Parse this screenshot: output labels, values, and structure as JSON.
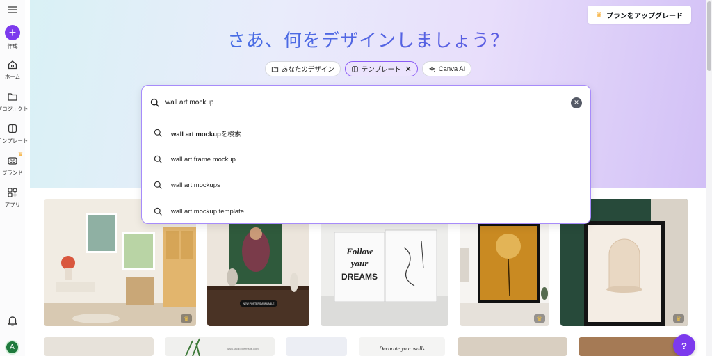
{
  "sidebar": {
    "create_label": "作成",
    "items": [
      {
        "label": "ホーム",
        "icon": "home-icon"
      },
      {
        "label": "プロジェクト",
        "icon": "folder-icon"
      },
      {
        "label": "テンプレート",
        "icon": "template-icon"
      },
      {
        "label": "ブランド",
        "icon": "brand-icon"
      },
      {
        "label": "アプリ",
        "icon": "apps-icon"
      }
    ],
    "avatar_initial": "A"
  },
  "header": {
    "upgrade_label": "プランをアップグレード",
    "title": "さあ、何をデザインしましょう？"
  },
  "chips": [
    {
      "label": "あなたのデザイン"
    },
    {
      "label": "テンプレート"
    },
    {
      "label": "Canva AI"
    }
  ],
  "search": {
    "value": "wall art mockup",
    "suggestions": [
      {
        "bold": "wall art mockup",
        "suffix": "を検索"
      },
      {
        "text": "wall art frame mockup"
      },
      {
        "text": "wall art mockups"
      },
      {
        "text": "wall art mockup template"
      }
    ]
  },
  "cards": {
    "poster_badge": "NEW POSTERS AVAILABLE",
    "follow_line1": "Follow",
    "follow_line2": "your",
    "follow_line3": "DREAMS",
    "decorate_text": "Decorate your walls",
    "url_text": "www.studiogreensite.com"
  },
  "help_label": "?",
  "colors": {
    "accent": "#7c3aed",
    "title": "#3f6ee8"
  }
}
